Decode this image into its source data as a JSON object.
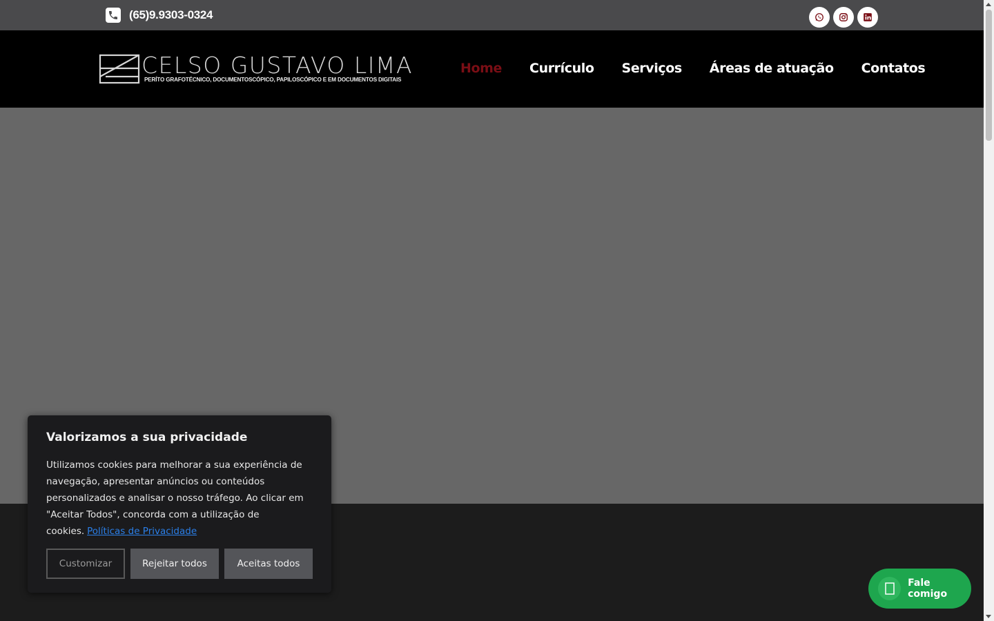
{
  "topbar": {
    "phone": "(65)9.9303-0324",
    "phone_icon": "phone-icon",
    "socials": [
      {
        "name": "whatsapp",
        "icon": "whatsapp-icon"
      },
      {
        "name": "instagram",
        "icon": "instagram-icon"
      },
      {
        "name": "linkedin",
        "icon": "linkedin-icon"
      }
    ]
  },
  "header": {
    "logo_name": "CELSO GUSTAVO LIMA",
    "logo_sub": "PERÍTO GRAFOTÉCNICO, DOCUMENTOSCÓPICO, PAPILOSCÓPICO E EM DOCUMENTOS DIGITAIS",
    "nav": [
      {
        "label": "Home",
        "active": true
      },
      {
        "label": "Currículo",
        "active": false
      },
      {
        "label": "Serviços",
        "active": false
      },
      {
        "label": "Áreas de atuação",
        "active": false
      },
      {
        "label": "Contatos",
        "active": false
      }
    ]
  },
  "cookie": {
    "title": "Valorizamos a sua privacidade",
    "body": "Utilizamos cookies para melhorar a sua experiência de navegação, apresentar anúncios ou conteúdos personalizados e analisar o nosso tráfego. Ao clicar em \"Aceitar Todos\", concorda com a utilização de cookies.",
    "link": "Políticas de Privacidade",
    "customize": "Customizar",
    "reject": "Rejeitar todos",
    "accept": "Aceitas todos"
  },
  "whatsapp": {
    "label": "Fale comigo",
    "icon": "whatsapp-icon"
  },
  "colors": {
    "topbar": "#4a4a4c",
    "header": "#000000",
    "active_nav": "#7a0e15",
    "hero": "#676767",
    "whatsapp": "#1ea64e"
  }
}
